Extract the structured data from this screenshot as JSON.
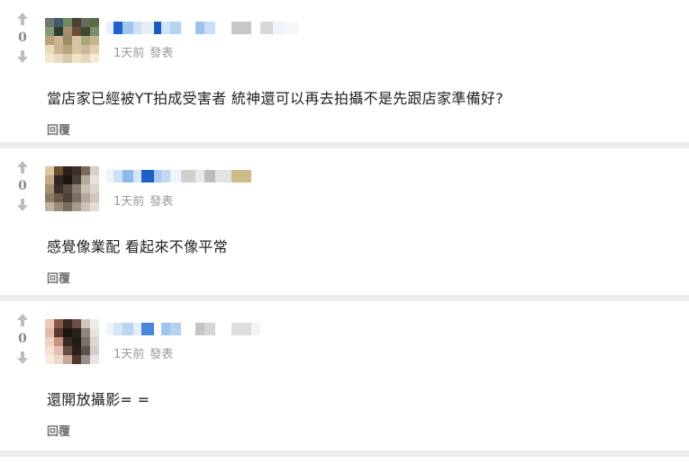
{
  "comments": [
    {
      "score": "0",
      "time": "1天前",
      "action": "發表",
      "text": "當店家已經被YT拍成受害者 統神還可以再去拍攝不是先跟店家準備好?",
      "reply_label": "回覆",
      "avatar_colors": [
        "#6e7b6a",
        "#3f5a6e",
        "#6f8a5f",
        "#4e4032",
        "#6a6a5e",
        "#5a6b48",
        "#889a77",
        "#2f3f2a",
        "#a58e6e",
        "#6c4c3a",
        "#3a4a34",
        "#7b8c6c",
        "#b9a178",
        "#cdb493",
        "#9c8d6a",
        "#d9c3a3",
        "#a7a97d",
        "#c8b587",
        "#e8d9ba",
        "#c9b48e",
        "#b8a27b",
        "#d6c7a4",
        "#cbb89a",
        "#e0d0b0",
        "#f1e6cf",
        "#e9dcc1",
        "#d8c9a9",
        "#efe3c9",
        "#e4d6b9",
        "#f4ead6"
      ],
      "name_colors": [
        "#e8f0fa",
        "#1f62c9",
        "#9fc4ee",
        "#cfe1f6",
        "#e4eef9",
        "#1a5bc2",
        "#d0e3f7",
        "#b7d3f2",
        "#ffffff",
        "#9cc3ee",
        "#c9def5",
        "#ffffff",
        "#c7c7c7",
        "#ffffff",
        "#d8d8d8",
        "#eef4fb",
        "#f7f7f7"
      ]
    },
    {
      "score": "0",
      "time": "1天前",
      "action": "發表",
      "text": "感覺像業配 看起來不像平常",
      "reply_label": "回覆",
      "avatar_colors": [
        "#d9c7a4",
        "#6d4c2f",
        "#2a211c",
        "#3c2f29",
        "#7a6a5a",
        "#d7d0c4",
        "#c6a887",
        "#2e2622",
        "#1b1614",
        "#4a3f39",
        "#b6aaa0",
        "#e6e1da",
        "#a88f75",
        "#3a302a",
        "#5a4b40",
        "#8a7c70",
        "#c9bfb4",
        "#dcd5cc",
        "#8d7a67",
        "#6b5a4c",
        "#4f4339",
        "#7d6f62",
        "#b3a79a",
        "#cfc7bc",
        "#c2b4a3",
        "#9c8c7b",
        "#7a6b5c",
        "#a99b8b",
        "#cdc1b3",
        "#e4ddd3"
      ],
      "name_colors": [
        "#eef4fb",
        "#cfe1f6",
        "#8fb9ea",
        "#d7e6f7",
        "#1e5fc5",
        "#a9caef",
        "#c2d9f3",
        "#eef4fb",
        "#cfcfcf",
        "#e9e9e9",
        "#bdbdbd",
        "#e3e3e3",
        "#cdbc8a",
        "#ffffff"
      ]
    },
    {
      "score": "0",
      "time": "1天前",
      "action": "發表",
      "text": "還開放攝影= =",
      "reply_label": "回覆",
      "avatar_colors": [
        "#e9c9b8",
        "#8a5a48",
        "#3b2a24",
        "#6e4e42",
        "#cfc7c2",
        "#efece9",
        "#e4b9a6",
        "#5a3a30",
        "#1c1412",
        "#2c201b",
        "#8f8580",
        "#e7e3e0",
        "#efd2c3",
        "#c6927c",
        "#3a2a24",
        "#241a16",
        "#7c7069",
        "#dcd6d2",
        "#f4e0d5",
        "#e2bfae",
        "#6a4c40",
        "#2a1f1b",
        "#5e534e",
        "#d5cfcb",
        "#f7ebe4",
        "#efd9cd",
        "#c8a898",
        "#4a3a33",
        "#9a8f8a",
        "#e9e5e2"
      ],
      "name_colors": [
        "#eef4fb",
        "#d3e5f7",
        "#bad4f2",
        "#e3eefa",
        "#4a86d6",
        "#ffffff",
        "#9fc4ee",
        "#b5d2f1",
        "#ffffff",
        "#c4c4c4",
        "#d5d5d5",
        "#ffffff",
        "#dedede",
        "#f3f3f3"
      ]
    }
  ]
}
